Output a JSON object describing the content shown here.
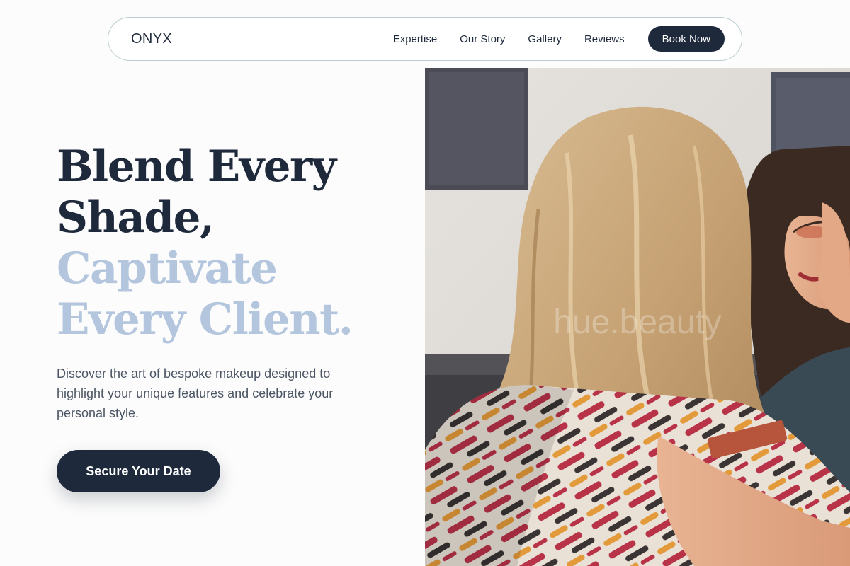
{
  "nav": {
    "logo": "ONYX",
    "links": [
      "Expertise",
      "Our Story",
      "Gallery",
      "Reviews"
    ],
    "cta": "Book Now"
  },
  "hero": {
    "headline_dark_1": "Blend Every",
    "headline_dark_2": "Shade,",
    "headline_light_1": "Captivate",
    "headline_light_2": "Every Client.",
    "lead": "Discover the art of bespoke makeup designed to highlight your unique features and celebrate your personal style.",
    "cta": "Secure Your Date"
  },
  "image": {
    "watermark": "hue.beauty"
  },
  "colors": {
    "primary": "#1e293b",
    "accent_light": "#b3c6de",
    "nav_border": "#b9cccf",
    "body_text": "#4b5563",
    "background": "#fcfcfc"
  }
}
